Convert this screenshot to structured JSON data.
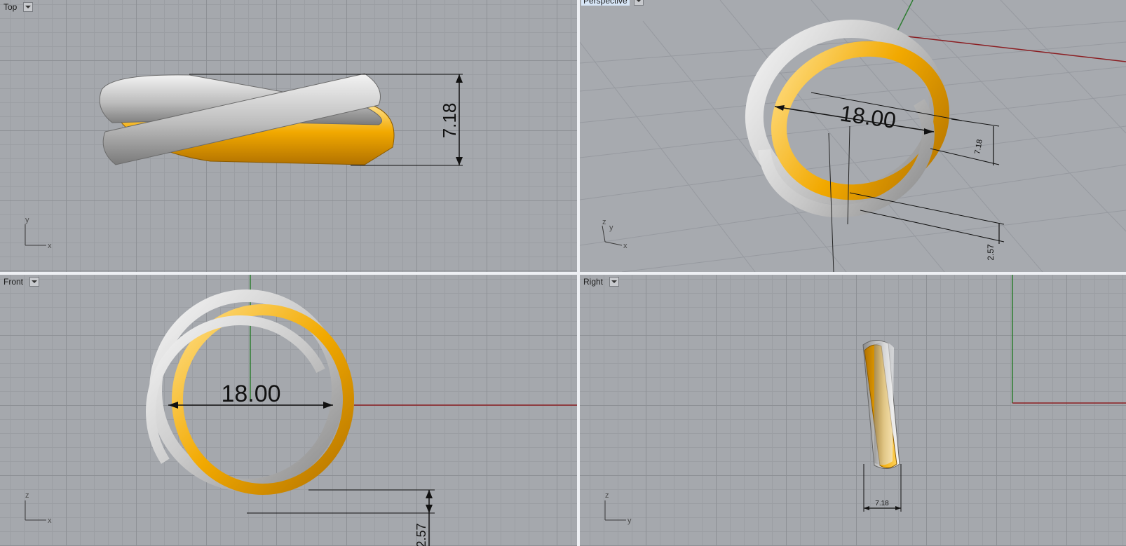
{
  "viewports": {
    "top": {
      "title": "Top",
      "axes": {
        "v": "y",
        "h": "x"
      },
      "dimension": "7.18"
    },
    "perspective": {
      "title": "Perspective",
      "axes": {
        "v": "z",
        "v2": "y",
        "h": "x"
      },
      "dimension_main": "18.00",
      "dimension_width": "7.18",
      "dimension_thickness": "2.57"
    },
    "front": {
      "title": "Front",
      "axes": {
        "v": "z",
        "h": "x"
      },
      "dimension_main": "18.00",
      "dimension_thickness": "2.57"
    },
    "right": {
      "title": "Right",
      "axes": {
        "v": "z",
        "h": "y"
      },
      "dimension_width": "7.18"
    }
  },
  "colors": {
    "gold": "#f2a900",
    "gold_dark": "#b27200",
    "silver": "#d8d8d8",
    "silver_dark": "#8c8c8c",
    "axis_red": "#8b1e22",
    "axis_green": "#2e7d32",
    "panel_border": "#eef0f4"
  }
}
